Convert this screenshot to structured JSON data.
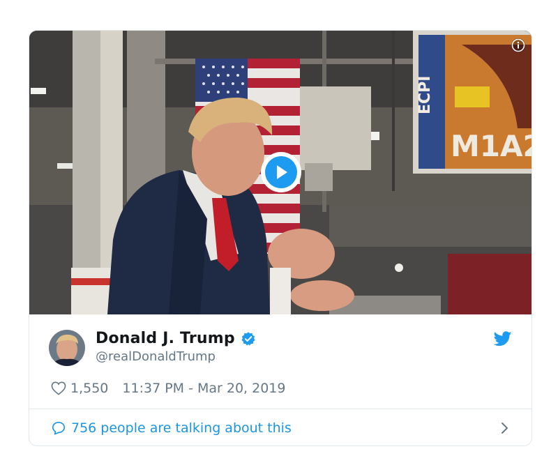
{
  "tweet": {
    "author_name": "Donald J. Trump",
    "author_handle": "@realDonaldTrump",
    "likes": "1,550",
    "timestamp": "11:37 PM - Mar 20, 2019",
    "talking_text": "756 people are talking about this"
  },
  "media": {
    "sign_text": "M1A2",
    "sign_side_text": "ECPI"
  },
  "colors": {
    "accent": "#1d9bf0",
    "link": "#1b95e0",
    "muted": "#657786",
    "border": "#e1e8ed"
  },
  "icons": [
    "info-icon",
    "play-icon",
    "verified-icon",
    "twitter-bird-icon",
    "heart-icon",
    "comment-bubble-icon",
    "chevron-right-icon"
  ]
}
